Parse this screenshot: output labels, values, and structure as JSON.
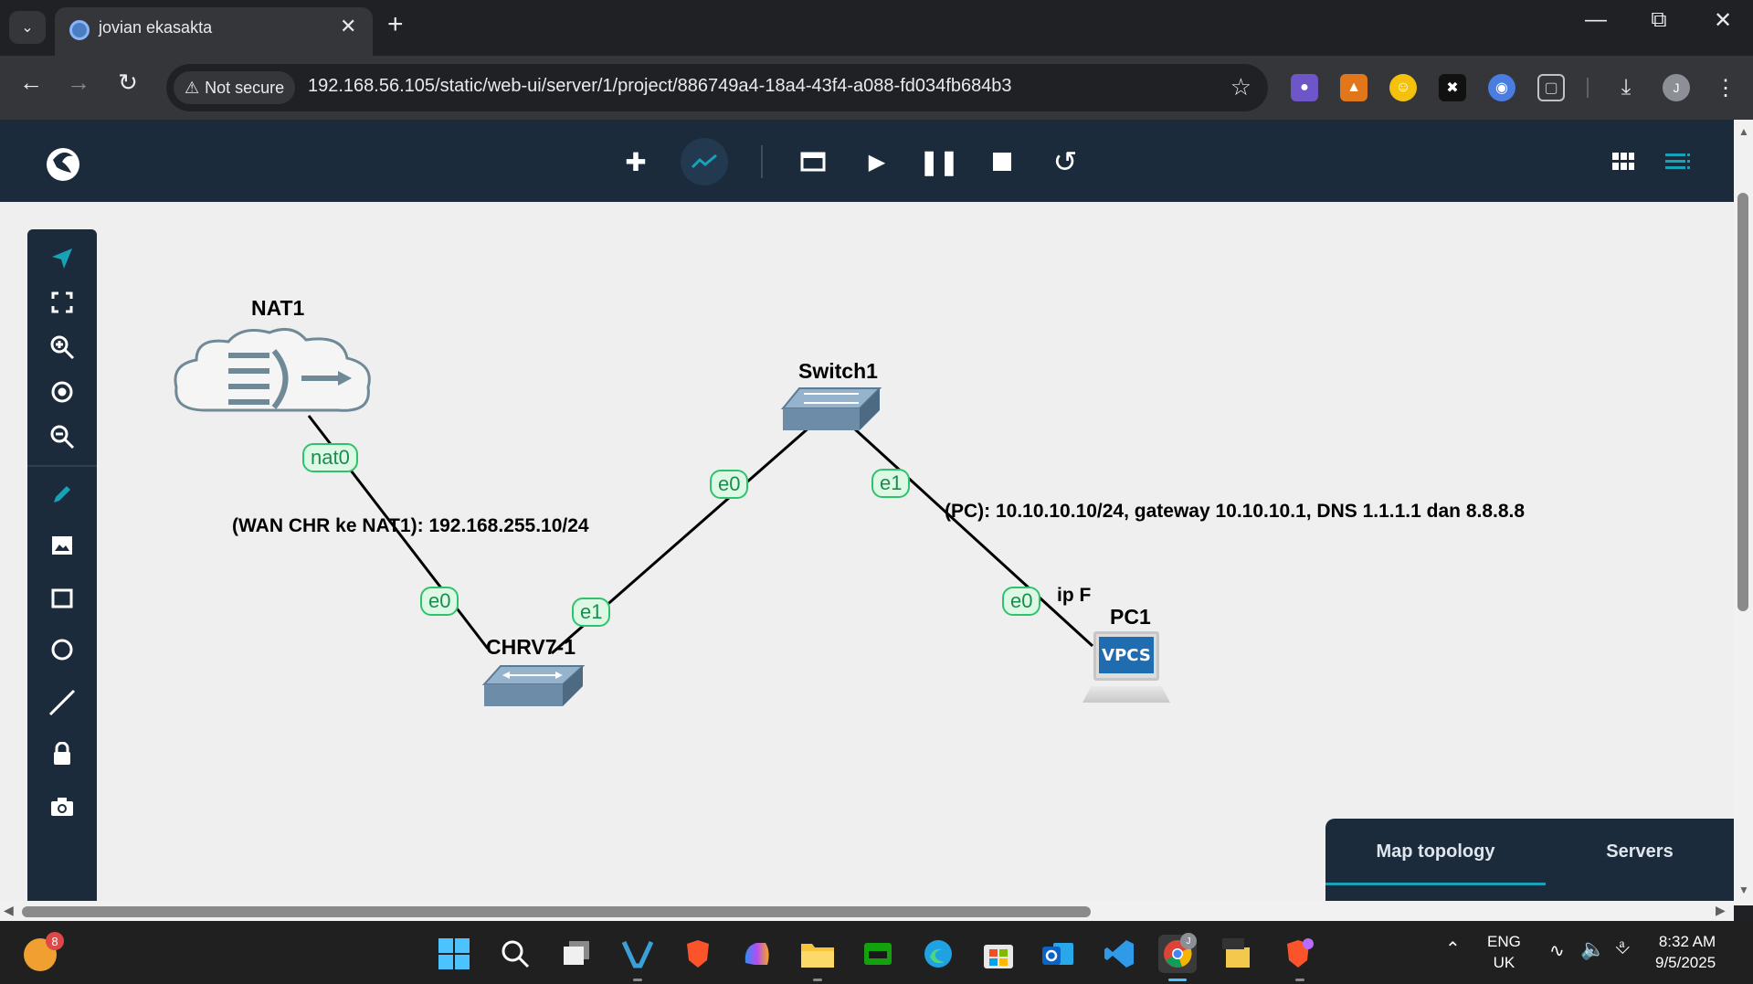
{
  "browser": {
    "tab_title": "jovian ekasakta",
    "security_label": "Not secure",
    "url": "192.168.56.105/static/web-ui/server/1/project/886749a4-18a4-43f4-a088-fd034fb684b3",
    "profile_initial": "J"
  },
  "topology": {
    "nodes": {
      "nat1": "NAT1",
      "switch1": "Switch1",
      "chrv7": "CHRV7-1",
      "pc1": "PC1"
    },
    "ports": {
      "nat1_nat0": "nat0",
      "chr_e0": "e0",
      "chr_e1": "e1",
      "switch_e0": "e0",
      "switch_e1": "e1",
      "pc_e0": "e0"
    },
    "vpcs_badge": "VPCS",
    "notes": {
      "wan": "(WAN CHR ke NAT1): 192.168.255.10/24",
      "pc": "(PC): 10.10.10.10/24, gateway 10.10.10.1, DNS 1.1.1.1 dan 8.8.8.8",
      "ip_fragment": "ip F"
    }
  },
  "panel": {
    "tabs": [
      "Map topology",
      "Servers"
    ]
  },
  "taskbar": {
    "weather_badge": "8",
    "language": "ENG",
    "region": "UK",
    "time": "8:32 AM",
    "date": "9/5/2025"
  },
  "colors": {
    "app_header": "#1b2b3c",
    "canvas": "#efefef",
    "port_border": "#2ec36b",
    "tab_underline": "#17a2b8"
  }
}
